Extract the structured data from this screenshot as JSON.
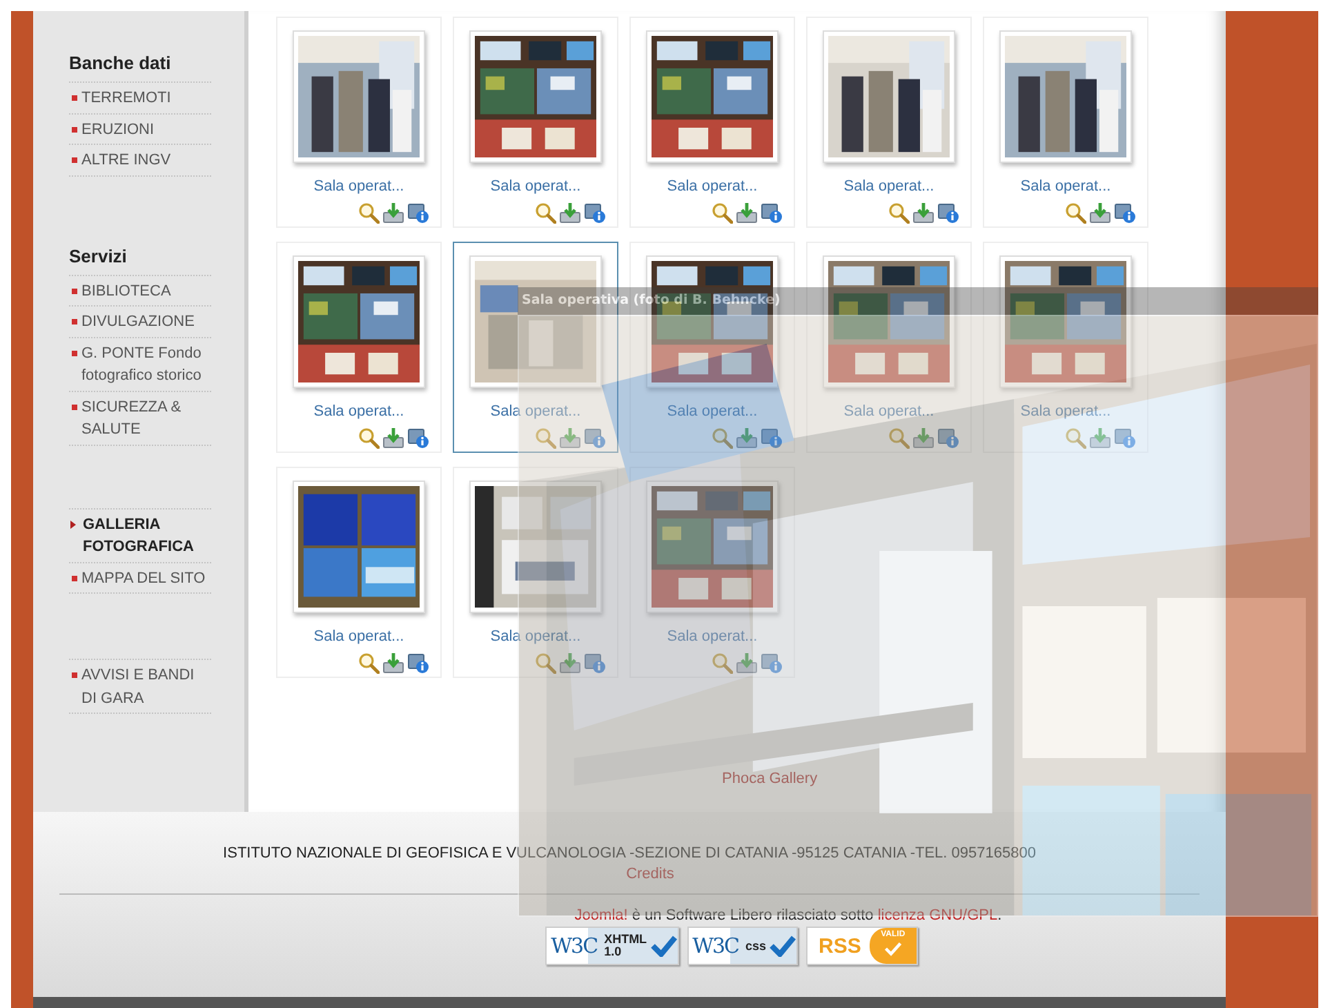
{
  "sidebar": {
    "sections": [
      {
        "title": "Banche dati",
        "items": [
          {
            "label": "TERREMOTI",
            "selected": false
          },
          {
            "label": "ERUZIONI",
            "selected": false
          },
          {
            "label": "ALTRE INGV",
            "selected": false
          }
        ]
      },
      {
        "title": "Servizi",
        "items": [
          {
            "label": "BIBLIOTECA",
            "selected": false
          },
          {
            "label": "DIVULGAZIONE",
            "selected": false
          },
          {
            "label": "G. PONTE Fondo fotografico storico",
            "selected": false
          },
          {
            "label": "SICUREZZA & SALUTE",
            "selected": false
          }
        ]
      },
      {
        "items": [
          {
            "label": "GALLERIA FOTOGRAFICA",
            "selected": true
          },
          {
            "label": "MAPPA DEL SITO",
            "selected": false
          }
        ]
      },
      {
        "items": [
          {
            "label": "AVVISI E BANDI DI GARA",
            "selected": false
          }
        ]
      }
    ]
  },
  "gallery": {
    "items": [
      {
        "caption": "Sala operat...",
        "selected": false
      },
      {
        "caption": "Sala operat...",
        "selected": false
      },
      {
        "caption": "Sala operat...",
        "selected": false
      },
      {
        "caption": "Sala operat...",
        "selected": false
      },
      {
        "caption": "Sala operat...",
        "selected": false
      },
      {
        "caption": "Sala operat...",
        "selected": false
      },
      {
        "caption": "Sala operat...",
        "selected": true
      },
      {
        "caption": "Sala operat...",
        "selected": false
      },
      {
        "caption": "Sala operat...",
        "selected": false
      },
      {
        "caption": "Sala operat...",
        "selected": false
      },
      {
        "caption": "Sala operat...",
        "selected": false
      },
      {
        "caption": "Sala operat...",
        "selected": false
      },
      {
        "caption": "Sala operat...",
        "selected": false
      }
    ],
    "footer_link": "Phoca Gallery"
  },
  "lightbox": {
    "title": "Sala operativa (foto di B. Behncke)"
  },
  "footer": {
    "address": "ISTITUTO NAZIONALE DI GEOFISICA E VULCANOLOGIA -SEZIONE DI CATANIA -95125 CATANIA -TEL. 0957165800",
    "credits": "Credits",
    "license": [
      {
        "text": "Joomla!",
        "link": true
      },
      {
        "text": " è un Software Libero rilasciato sotto ",
        "link": false
      },
      {
        "text": "licenza GNU/GPL",
        "link": true
      },
      {
        "text": ".",
        "link": false
      }
    ],
    "badges": [
      {
        "kind": "w3c",
        "logo": "W3C",
        "label": "XHTML",
        "version": "1.0"
      },
      {
        "kind": "w3c",
        "logo": "W3C",
        "label": "css"
      },
      {
        "kind": "rss",
        "label": "RSS",
        "seal": "VALID"
      }
    ]
  }
}
